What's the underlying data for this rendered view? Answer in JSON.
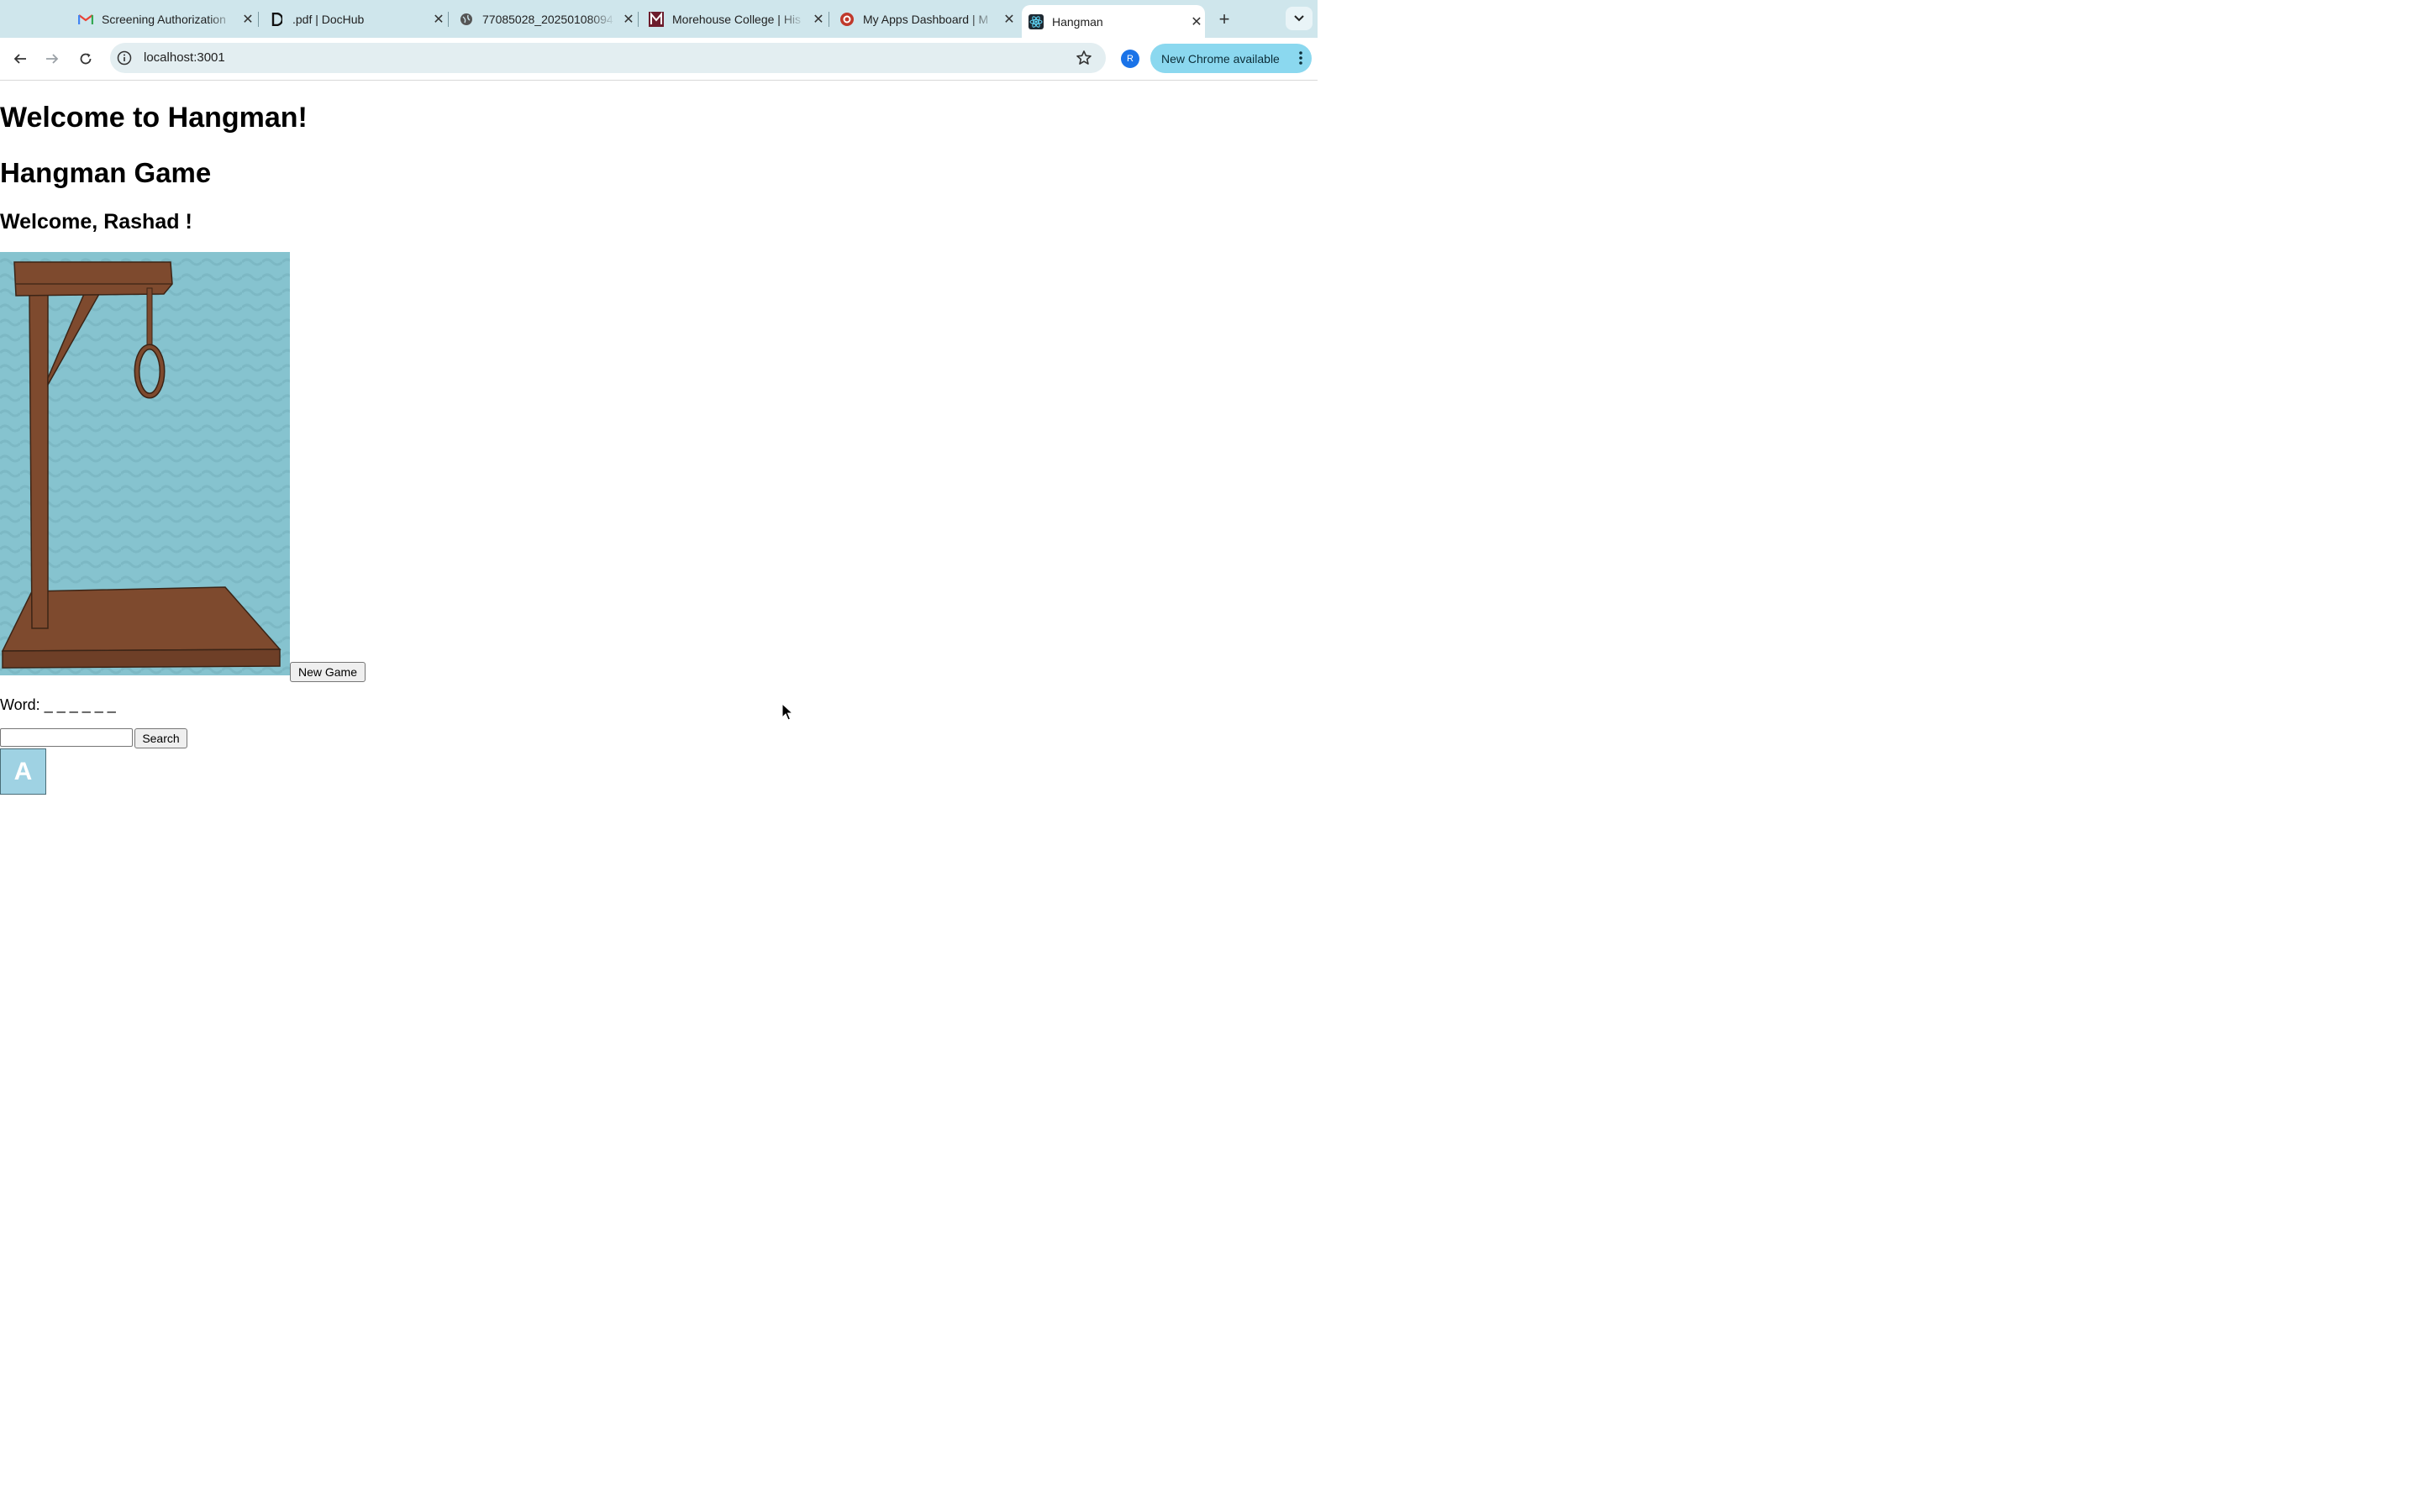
{
  "browser": {
    "tabs": [
      {
        "title": "Screening Authorization",
        "favicon": "gmail-icon",
        "active": false
      },
      {
        "title": ".pdf | DocHub",
        "favicon": "dochub-icon",
        "active": false
      },
      {
        "title": "77085028_20250108094",
        "favicon": "globe-icon",
        "active": false
      },
      {
        "title": "Morehouse College | His",
        "favicon": "morehouse-icon",
        "active": false
      },
      {
        "title": "My Apps Dashboard | M",
        "favicon": "apps-icon",
        "active": false
      },
      {
        "title": "Hangman",
        "favicon": "react-icon",
        "active": true
      }
    ],
    "url": "localhost:3001",
    "profile_initial": "R",
    "update_label": "New Chrome available"
  },
  "page": {
    "heading": "Welcome to Hangman!",
    "game_title": "Hangman Game",
    "greeting": "Welcome, Rashad !",
    "new_game_label": "New Game",
    "word_label": "Word:",
    "word_mask": "_ _ _ _ _ _",
    "search_value": "",
    "search_label": "Search",
    "letters": [
      "A"
    ]
  },
  "colors": {
    "tabstrip": "#cfe6ec",
    "gallows_wood": "#7e4a2e",
    "art_background": "#86c3cf",
    "letter_tile": "#9fd2e3",
    "update_pill": "#8bd8ef"
  }
}
